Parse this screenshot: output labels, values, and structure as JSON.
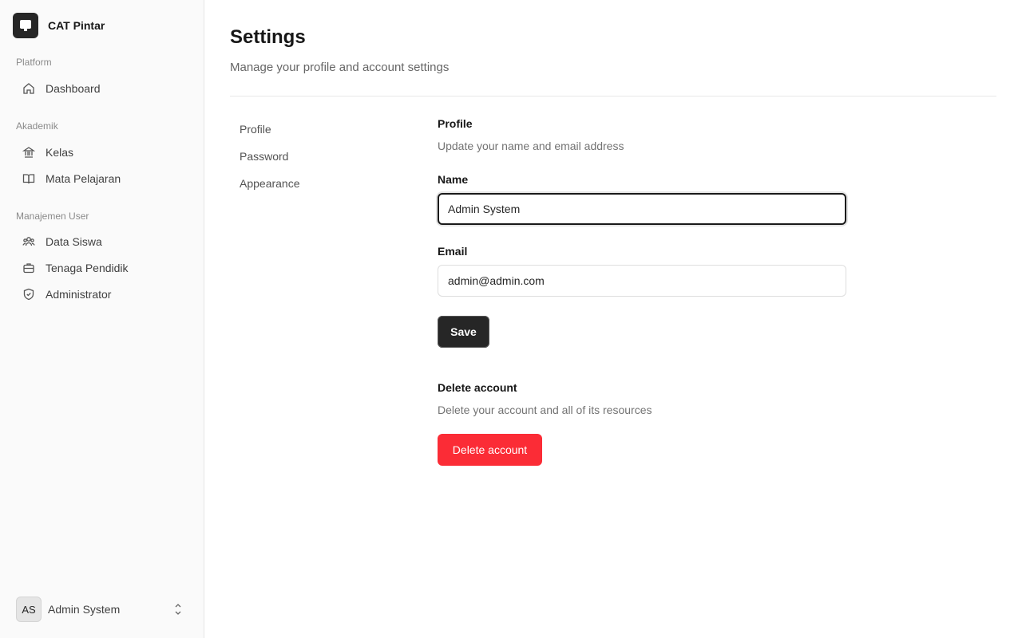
{
  "brand": {
    "name": "CAT Pintar",
    "icon": "monitor-icon"
  },
  "sidebar": {
    "groups": [
      {
        "label": "Platform",
        "items": [
          {
            "label": "Dashboard",
            "icon": "home-icon"
          }
        ]
      },
      {
        "label": "Akademik",
        "items": [
          {
            "label": "Kelas",
            "icon": "building-icon"
          },
          {
            "label": "Mata Pelajaran",
            "icon": "book-icon"
          }
        ]
      },
      {
        "label": "Manajemen User",
        "items": [
          {
            "label": "Data Siswa",
            "icon": "users-icon"
          },
          {
            "label": "Tenaga Pendidik",
            "icon": "briefcase-icon"
          },
          {
            "label": "Administrator",
            "icon": "shield-icon"
          }
        ]
      }
    ],
    "user": {
      "initials": "AS",
      "name": "Admin System"
    }
  },
  "page": {
    "title": "Settings",
    "subtitle": "Manage your profile and account settings"
  },
  "tabs": [
    {
      "label": "Profile"
    },
    {
      "label": "Password"
    },
    {
      "label": "Appearance"
    }
  ],
  "profile": {
    "title": "Profile",
    "description": "Update your name and email address",
    "name_label": "Name",
    "name_value": "Admin System",
    "email_label": "Email",
    "email_value": "admin@admin.com",
    "save_label": "Save"
  },
  "delete": {
    "title": "Delete account",
    "description": "Delete your account and all of its resources",
    "button_label": "Delete account"
  },
  "colors": {
    "primary": "#262626",
    "danger": "#fb2c36",
    "sidebar_bg": "#fafafa"
  }
}
